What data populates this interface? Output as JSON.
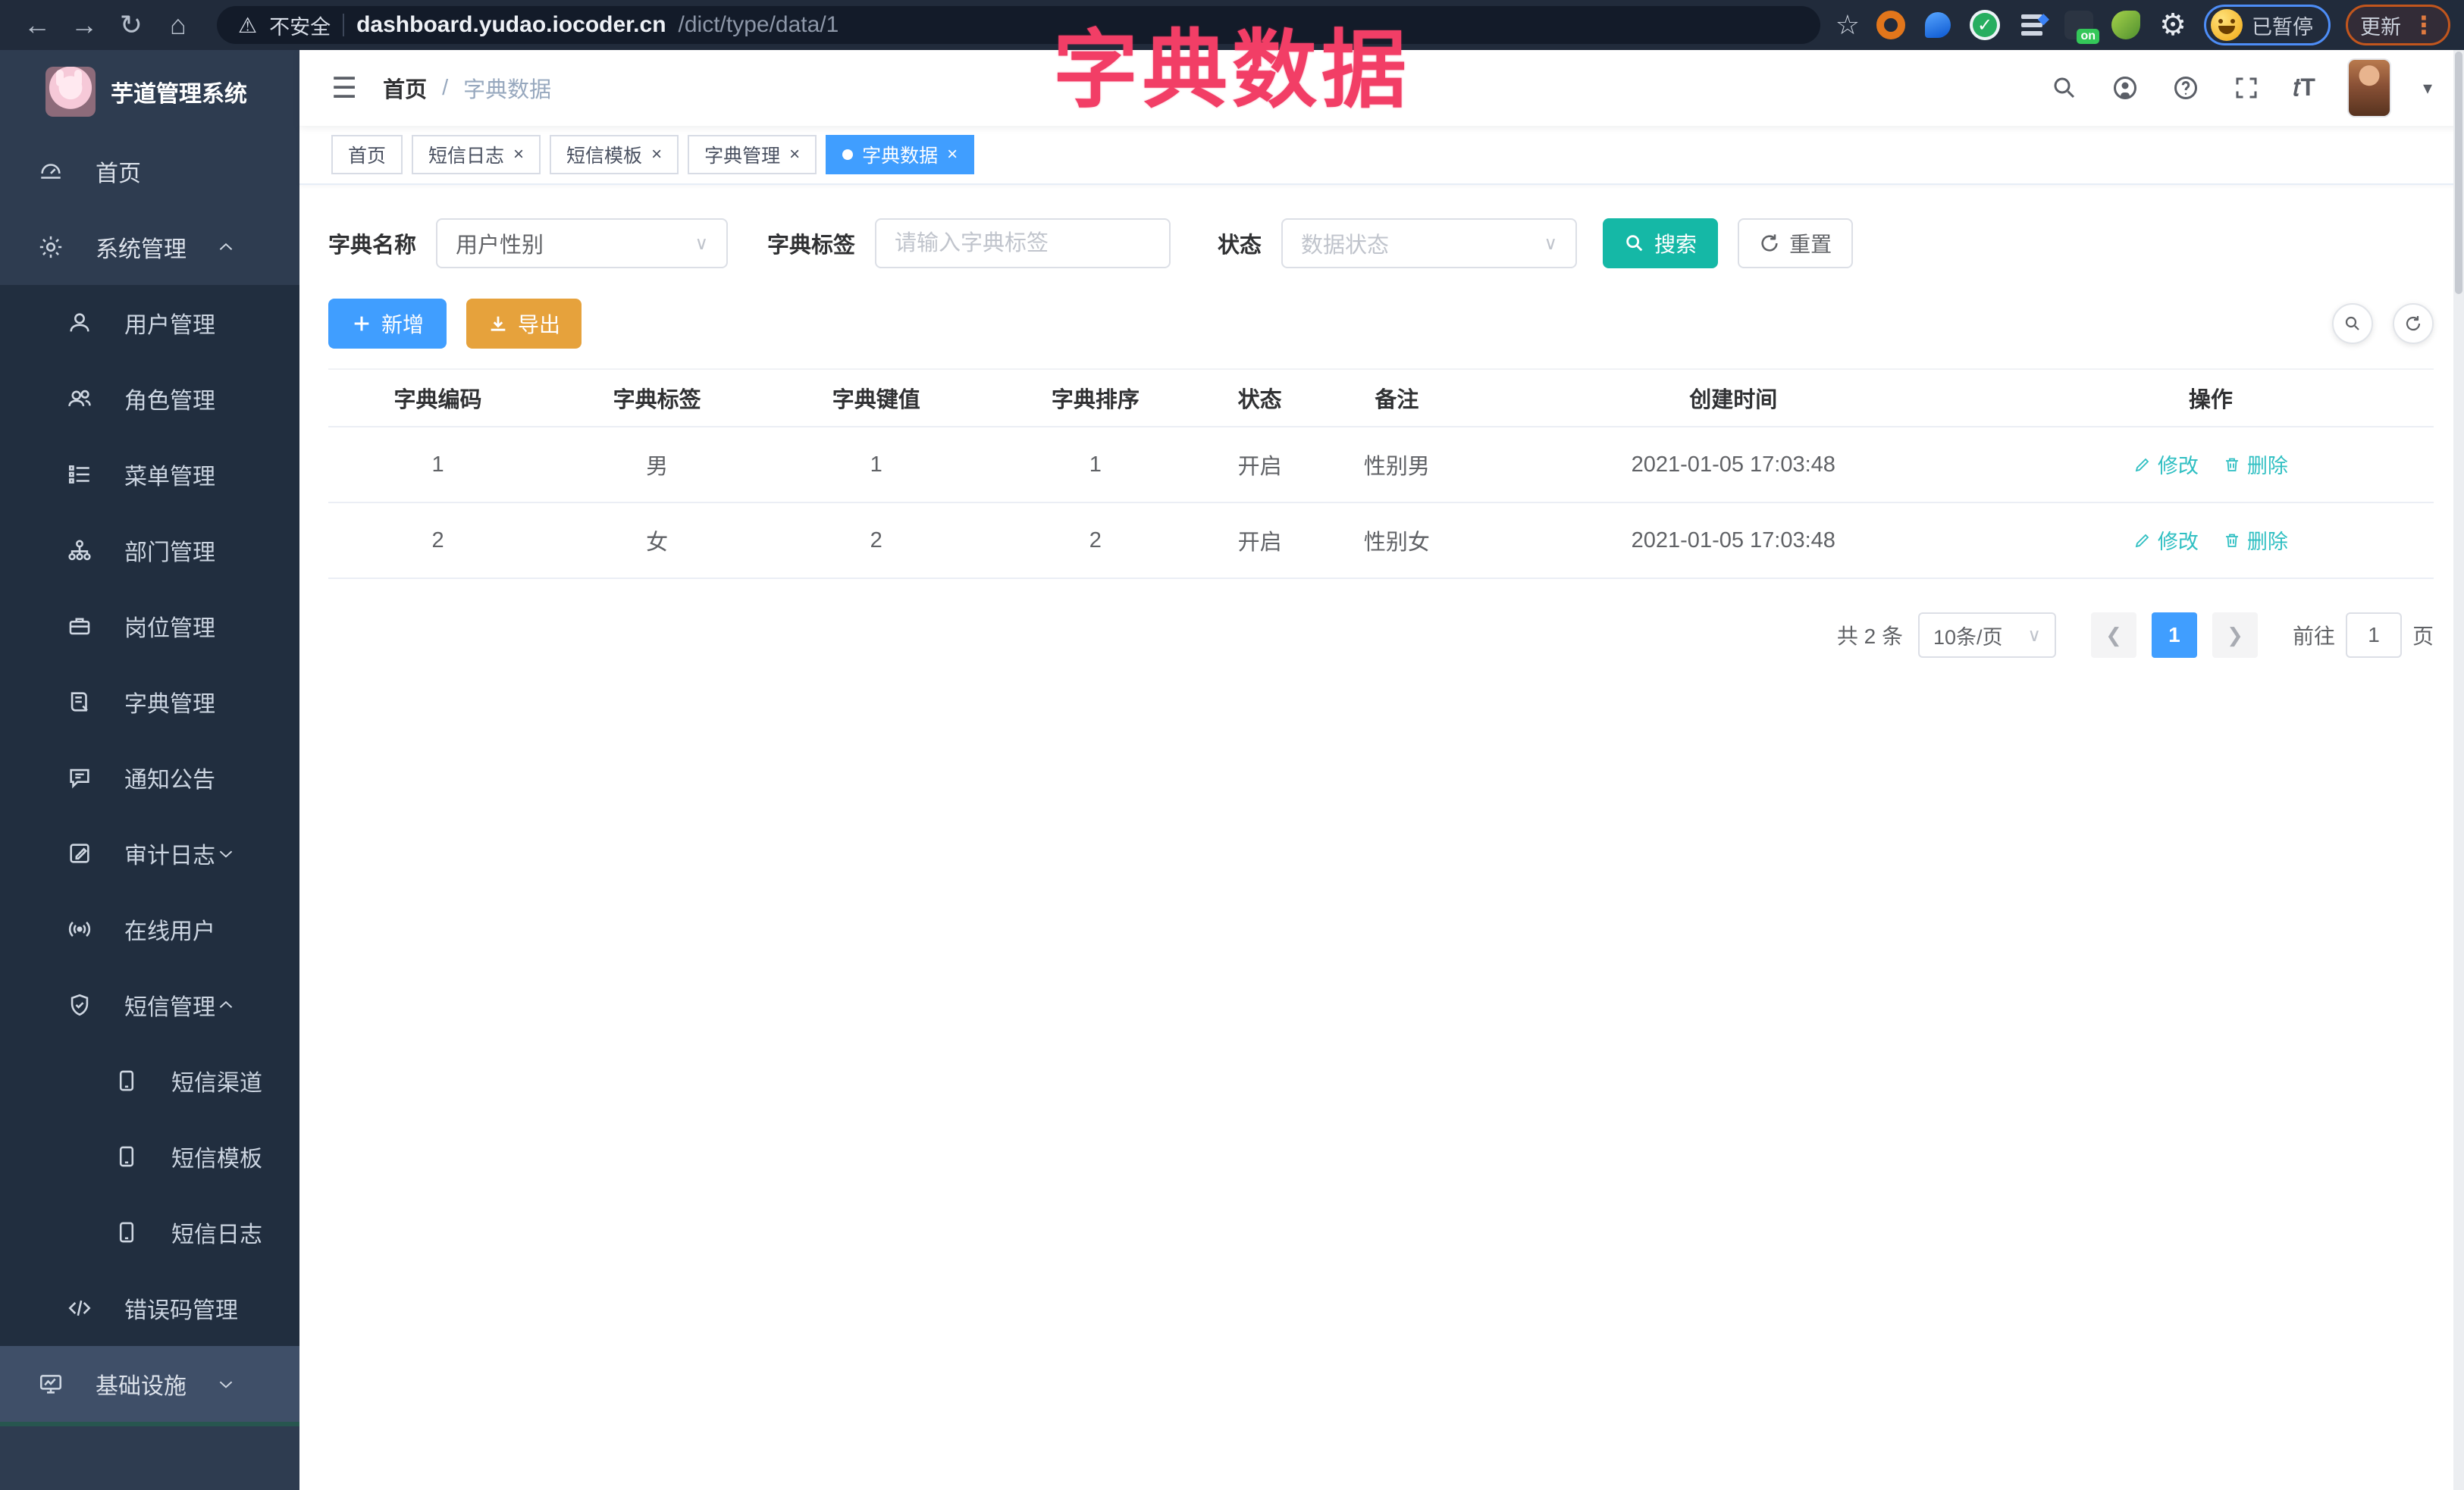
{
  "browser": {
    "security_label": "不安全",
    "url_host": "dashboard.yudao.iocoder.cn",
    "url_path": "/dict/type/data/1",
    "profile_status": "已暂停",
    "update_label": "更新",
    "on_badge_label": "on"
  },
  "overlay_title": "字典数据",
  "sidebar": {
    "logo_title": "芋道管理系统",
    "items": [
      {
        "id": "home",
        "label": "首页",
        "level": 1,
        "icon": "dashboard-icon"
      },
      {
        "id": "system",
        "label": "系统管理",
        "level": 1,
        "icon": "gear-icon",
        "caret": "up"
      },
      {
        "id": "user",
        "label": "用户管理",
        "level": 2,
        "icon": "user-icon"
      },
      {
        "id": "role",
        "label": "角色管理",
        "level": 2,
        "icon": "users-icon"
      },
      {
        "id": "menu",
        "label": "菜单管理",
        "level": 2,
        "icon": "menu-list-icon"
      },
      {
        "id": "dept",
        "label": "部门管理",
        "level": 2,
        "icon": "org-tree-icon"
      },
      {
        "id": "post",
        "label": "岗位管理",
        "level": 2,
        "icon": "briefcase-icon"
      },
      {
        "id": "dict",
        "label": "字典管理",
        "level": 2,
        "icon": "book-icon"
      },
      {
        "id": "notice",
        "label": "通知公告",
        "level": 2,
        "icon": "message-icon"
      },
      {
        "id": "audit",
        "label": "审计日志",
        "level": 2,
        "icon": "edit-log-icon",
        "caret": "down"
      },
      {
        "id": "online",
        "label": "在线用户",
        "level": 2,
        "icon": "online-icon"
      },
      {
        "id": "sms",
        "label": "短信管理",
        "level": 2,
        "icon": "shield-check-icon",
        "caret": "up"
      },
      {
        "id": "sms-channel",
        "label": "短信渠道",
        "level": 3,
        "icon": "phone-icon"
      },
      {
        "id": "sms-template",
        "label": "短信模板",
        "level": 3,
        "icon": "phone-icon"
      },
      {
        "id": "sms-log",
        "label": "短信日志",
        "level": 3,
        "icon": "phone-icon"
      },
      {
        "id": "errcode",
        "label": "错误码管理",
        "level": 2,
        "icon": "code-icon"
      },
      {
        "id": "infra",
        "label": "基础设施",
        "level": 1,
        "icon": "monitor-icon",
        "caret": "down",
        "highlight": true
      }
    ]
  },
  "header": {
    "breadcrumb_home": "首页",
    "breadcrumb_separator": "/",
    "breadcrumb_current": "字典数据"
  },
  "tabs": [
    {
      "label": "首页",
      "closable": false,
      "active": false
    },
    {
      "label": "短信日志",
      "closable": true,
      "active": false
    },
    {
      "label": "短信模板",
      "closable": true,
      "active": false
    },
    {
      "label": "字典管理",
      "closable": true,
      "active": false
    },
    {
      "label": "字典数据",
      "closable": true,
      "active": true
    }
  ],
  "filters": {
    "dict_name_label": "字典名称",
    "dict_name_value": "用户性别",
    "dict_label_label": "字典标签",
    "dict_label_placeholder": "请输入字典标签",
    "status_label": "状态",
    "status_placeholder": "数据状态",
    "search_label": "搜索",
    "reset_label": "重置"
  },
  "toolbar": {
    "add_label": "新增",
    "export_label": "导出"
  },
  "table": {
    "headers": [
      "字典编码",
      "字典标签",
      "字典键值",
      "字典排序",
      "状态",
      "备注",
      "创建时间",
      "操作"
    ],
    "rows": [
      {
        "code": "1",
        "label": "男",
        "value": "1",
        "sort": "1",
        "status": "开启",
        "remark": "性别男",
        "created": "2021-01-05 17:03:48"
      },
      {
        "code": "2",
        "label": "女",
        "value": "2",
        "sort": "2",
        "status": "开启",
        "remark": "性别女",
        "created": "2021-01-05 17:03:48"
      }
    ],
    "edit_label": "修改",
    "delete_label": "删除"
  },
  "pagination": {
    "total_label": "共 2 条",
    "page_size_label": "10条/页",
    "current_page": "1",
    "goto_label": "前往",
    "goto_value": "1",
    "page_unit_label": "页"
  },
  "colors": {
    "accent_teal": "#15b8a6",
    "action_link_teal": "#2fbfc2",
    "primary_blue": "#409EFF",
    "warning_orange": "#E6A23C",
    "overlay_pink": "#f23e66",
    "sidebar_bg": "#2e3c50",
    "sidebar_submenu_bg": "#212e3f",
    "browser_bar_bg": "#212b3b"
  }
}
